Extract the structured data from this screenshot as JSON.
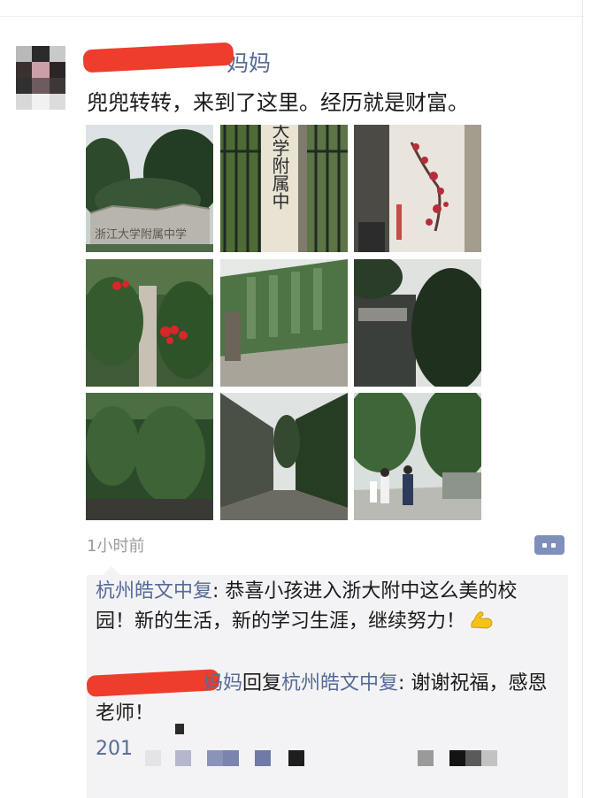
{
  "post": {
    "username_visible": "妈妈",
    "text": "兜兜转转，来到了这里。经历就是财富。",
    "timestamp": "1小时前",
    "photos": [
      {
        "scene": "stone-sign",
        "sign_text": "浙江大学附属中学"
      },
      {
        "scene": "gate-plaque",
        "sign_text": "浙江大学附属中"
      },
      {
        "scene": "blossom-wall"
      },
      {
        "scene": "red-flowers-vines"
      },
      {
        "scene": "ivy-building"
      },
      {
        "scene": "tree-corner"
      },
      {
        "scene": "ivy-wall"
      },
      {
        "scene": "dark-pathway"
      },
      {
        "scene": "students-walkway"
      }
    ]
  },
  "comments": [
    {
      "author": "杭州皓文中复",
      "separator": ": ",
      "text": "恭喜小孩进入浙大附中这么美的校园！新的生活，新的学习生涯，继续努力！",
      "emoji": "flexed-biceps"
    },
    {
      "author_visible": "妈妈",
      "reply_word": "回复",
      "reply_to": "杭州皓文中复",
      "separator": ": ",
      "text": "谢谢祝福，感恩老师！"
    }
  ],
  "truncated_text": "201",
  "colors": {
    "name_link": "#576b95",
    "timestamp": "#9b9b9b",
    "comment_bg": "#f3f3f5",
    "redaction": "#ee3d2c"
  }
}
